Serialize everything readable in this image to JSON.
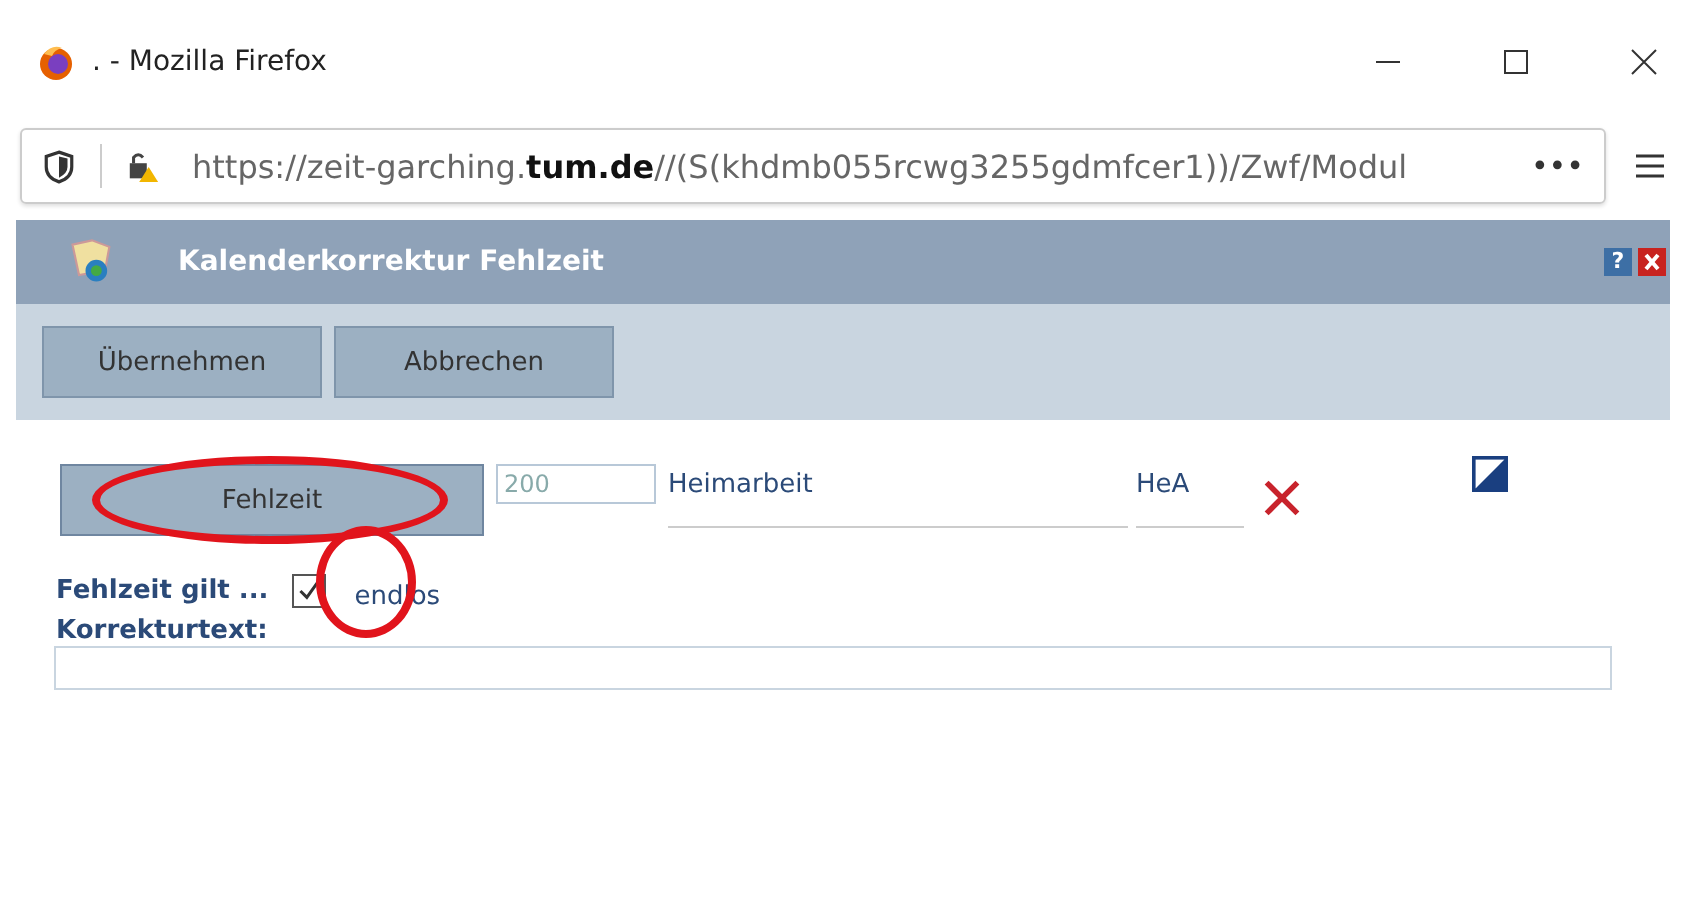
{
  "window": {
    "title": ". - Mozilla Firefox"
  },
  "address_bar": {
    "url": "https://zeit-garching.**tum.de**//(S(khdmb055rcwg3255gdmfcer1))/Zwf/Modul",
    "more": "•••"
  },
  "dialog": {
    "title": "Kalenderkorrektur Fehlzeit",
    "help": "?"
  },
  "toolbar": {
    "buttons": [
      "Übernehmen",
      "Abbrechen"
    ]
  },
  "form": {
    "type_button": "Fehlzeit",
    "code": "200",
    "name": "Heimarbeit",
    "short": "HeA",
    "valid_label": "Fehlzeit gilt ...",
    "endless": {
      "label": "endlos",
      "checked": true
    },
    "text_label": "Korrekturtext:"
  },
  "annotations": [
    {
      "kind": "ellipse"
    },
    {
      "kind": "circle"
    }
  ]
}
